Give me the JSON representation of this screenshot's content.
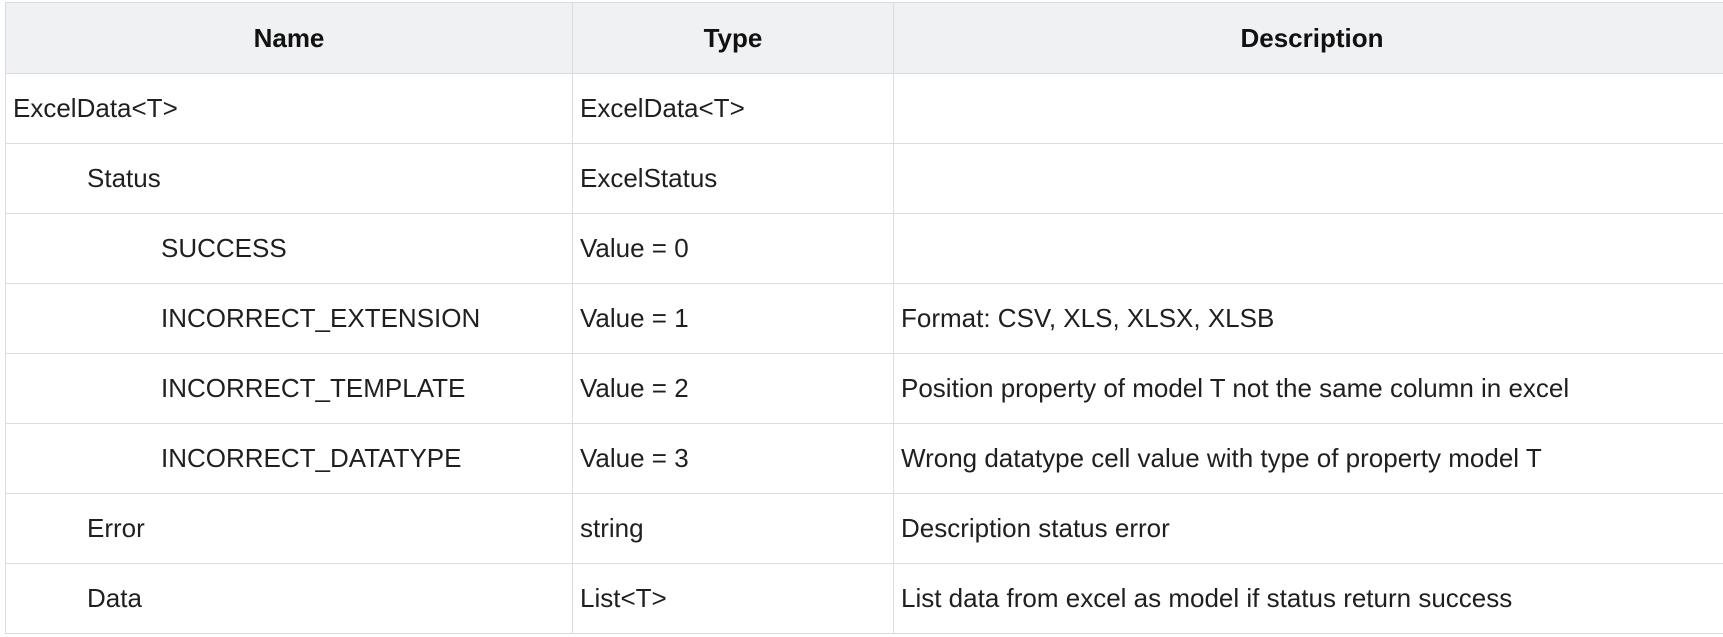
{
  "table": {
    "headers": {
      "name": "Name",
      "type": "Type",
      "description": "Description"
    },
    "rows": [
      {
        "name": "ExcelData<T>",
        "type": "ExcelData<T>",
        "description": "",
        "indent": 0
      },
      {
        "name": "Status",
        "type": "ExcelStatus",
        "description": "",
        "indent": 1
      },
      {
        "name": "SUCCESS",
        "type": "Value = 0",
        "description": "",
        "indent": 2
      },
      {
        "name": "INCORRECT_EXTENSION",
        "type": "Value = 1",
        "description": "Format: CSV, XLS, XLSX, XLSB",
        "indent": 2
      },
      {
        "name": "INCORRECT_TEMPLATE",
        "type": "Value = 2",
        "description": "Position property of model T not the same column in excel",
        "indent": 2
      },
      {
        "name": "INCORRECT_DATATYPE",
        "type": "Value = 3",
        "description": "Wrong datatype cell value with type of property model T",
        "indent": 2
      },
      {
        "name": "Error",
        "type": "string",
        "description": "Description status error",
        "indent": 1
      },
      {
        "name": "Data",
        "type": "List<T>",
        "description": "List data from excel as model if status return success",
        "indent": 1
      }
    ]
  }
}
